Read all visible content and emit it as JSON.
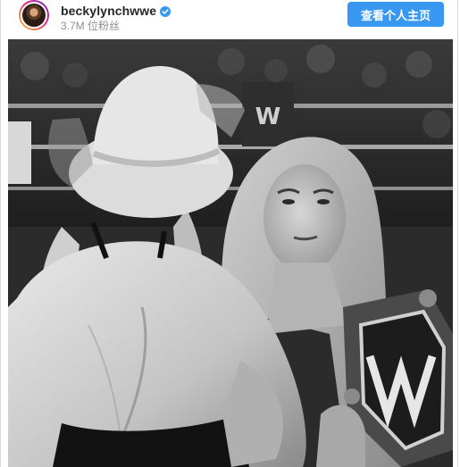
{
  "post": {
    "username": "beckylynchwwe",
    "followers": "3.7M 位粉丝",
    "follow_button_label": "查看个人主页",
    "verified_icon": "verified-badge-icon",
    "accent_color": "#3897f0"
  },
  "photo": {
    "alt": "black and white wrestling photo"
  }
}
